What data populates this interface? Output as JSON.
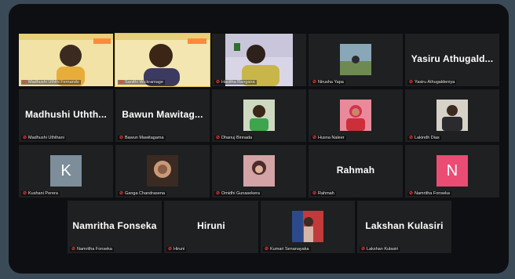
{
  "participants": [
    {
      "label": "Madhushi Uththi Fernando",
      "type": "video"
    },
    {
      "label": "Sanithi Wickramage",
      "type": "video"
    },
    {
      "label": "Hasitha Rangana",
      "type": "video"
    },
    {
      "label": "Nirusha Yapa",
      "type": "photo"
    },
    {
      "name": "Yasiru Athugald...",
      "label": "Yasiru Athugaldeniya"
    },
    {
      "name": "Madhushi Uthth...",
      "label": "Madhushi Uththani"
    },
    {
      "name": "Bawun Mawitag...",
      "label": "Bawun Mawitagama"
    },
    {
      "label": "Dhanuj Binnada",
      "type": "photo"
    },
    {
      "label": "Husna Naleer",
      "type": "photo"
    },
    {
      "label": "Lakindh Dias",
      "type": "photo"
    },
    {
      "letter": "K",
      "label": "Kushani Perera",
      "color": "#7d8e9a"
    },
    {
      "label": "Ganga Chandrasena",
      "type": "photo"
    },
    {
      "label": "Omidhi Gunasekera",
      "type": "photo"
    },
    {
      "name": "Rahmah",
      "label": "Rahmah"
    },
    {
      "letter": "N",
      "label": "Namritha Fonseka",
      "color": "#ea4c74"
    },
    {
      "name": "Namritha Fonseka",
      "label": "Namritha Fonseka"
    },
    {
      "name": "Hiruni",
      "label": "Hiruni"
    },
    {
      "label": "Kumari Senanayaka",
      "type": "photo"
    },
    {
      "name": "Lakshan Kulasiri",
      "label": "Lakshan Kulasiri"
    }
  ],
  "colors": {
    "speaker_highlight": "#e7c64b",
    "muted_mic": "#ff3b3b"
  }
}
